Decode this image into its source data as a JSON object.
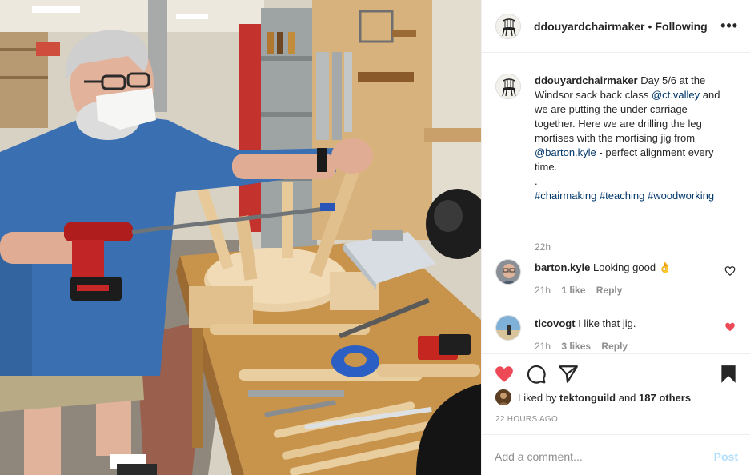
{
  "post": {
    "username": "ddouyardchairmaker",
    "follow_status": "Following",
    "separator": "•",
    "more_icon": "more-horizontal-icon",
    "caption": {
      "username": "ddouyardchairmaker",
      "text_1": "Day 5/6 at the Windsor sack back class",
      "mention_1": "@ct.valley",
      "text_2": "and we are putting the under carriage together. Here we are drilling the leg mortises with the mortising jig from",
      "mention_2": "@barton.kyle",
      "text_3": "- perfect alignment every time.",
      "dot_line": ".",
      "hashtag_1": "#chairmaking",
      "hashtag_2": "#teaching",
      "hashtag_3": "#woodworking",
      "time": "22h"
    },
    "comments": [
      {
        "username": "barton.kyle",
        "text": "Looking good 👌",
        "time": "21h",
        "likes": "1 like",
        "reply": "Reply",
        "liked": false
      },
      {
        "username": "ticovogt",
        "text": "I like that jig.",
        "time": "21h",
        "likes": "3 likes",
        "reply": "Reply",
        "liked": true
      }
    ],
    "liked_by_prefix": "Liked by",
    "liked_by_user": "tektonguild",
    "liked_by_connector": "and",
    "liked_by_others": "187 others",
    "date": "22 HOURS AGO",
    "comment_placeholder": "Add a comment...",
    "post_label": "Post",
    "colors": {
      "like_red": "#ed4956",
      "link": "#00376b",
      "post_disabled": "#b2dffc",
      "muted": "#8e8e8e"
    }
  }
}
